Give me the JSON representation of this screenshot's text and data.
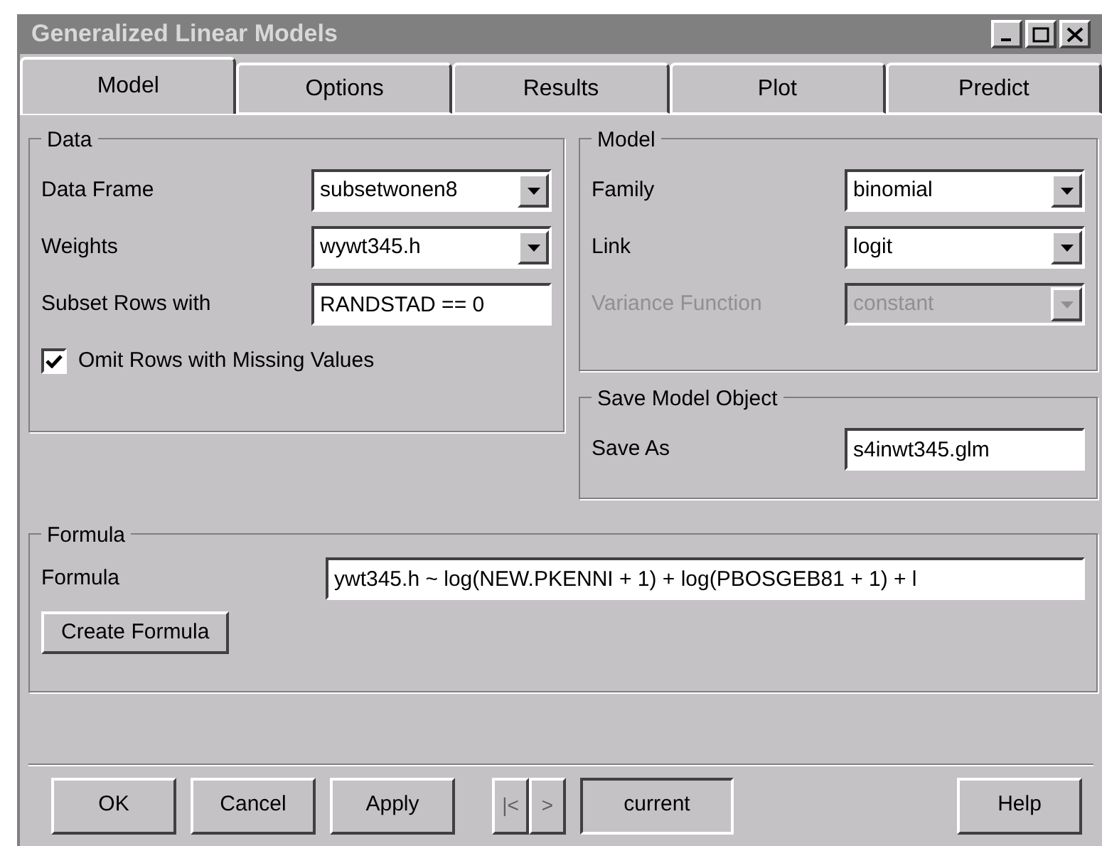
{
  "window": {
    "title": "Generalized Linear Models"
  },
  "tabs": [
    {
      "label": "Model",
      "selected": true
    },
    {
      "label": "Options",
      "selected": false
    },
    {
      "label": "Results",
      "selected": false
    },
    {
      "label": "Plot",
      "selected": false
    },
    {
      "label": "Predict",
      "selected": false
    }
  ],
  "data_group": {
    "title": "Data",
    "fields": [
      {
        "kind": "dropdown",
        "label": "Data Frame",
        "value": "subsetwonen8",
        "disabled": false
      },
      {
        "kind": "dropdown",
        "label": "Weights",
        "value": "wywt345.h",
        "disabled": false
      },
      {
        "kind": "text",
        "label": "Subset Rows with",
        "value": "RANDSTAD == 0"
      }
    ],
    "checkbox": {
      "label": "Omit Rows with Missing Values",
      "checked": true
    }
  },
  "model_group": {
    "title": "Model",
    "fields": [
      {
        "kind": "dropdown",
        "label": "Family",
        "value": "binomial",
        "disabled": false
      },
      {
        "kind": "dropdown",
        "label": "Link",
        "value": "logit",
        "disabled": false
      },
      {
        "kind": "dropdown",
        "label": "Variance Function",
        "value": "constant",
        "disabled": true
      }
    ]
  },
  "save_group": {
    "title": "Save Model Object",
    "label": "Save As",
    "value": "s4inwt345.glm"
  },
  "formula_group": {
    "title": "Formula",
    "label": "Formula",
    "value": "ywt345.h ~ log(NEW.PKENNI + 1) + log(PBOSGEB81 + 1) + l",
    "button": "Create Formula"
  },
  "buttons": [
    {
      "kind": "button",
      "label": "OK",
      "disabled": false
    },
    {
      "kind": "button",
      "label": "Cancel",
      "disabled": false
    },
    {
      "kind": "button",
      "label": "Apply",
      "disabled": false
    },
    {
      "kind": "nav",
      "label": "|<",
      "disabled": true
    },
    {
      "kind": "nav",
      "label": ">",
      "disabled": true
    },
    {
      "kind": "field",
      "label": "current",
      "disabled": false
    },
    {
      "kind": "button",
      "label": "Help",
      "disabled": false
    }
  ]
}
